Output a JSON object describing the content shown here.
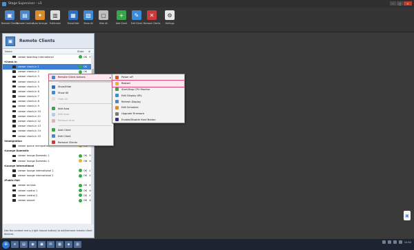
{
  "window": {
    "title": "Stage Supervisor - v3"
  },
  "toolbar": {
    "buttons": [
      {
        "label": "Remote Clients",
        "icon": "monitor-icon",
        "color": "#4a86c8",
        "glyph": "▣"
      },
      {
        "label": "Remote Control",
        "icon": "remote-icon",
        "color": "#4a86c8",
        "glyph": "▤"
      },
      {
        "label": "Auto Arrange",
        "icon": "arrange-icon",
        "color": "#d98a2b",
        "glyph": "✦"
      },
      {
        "label": "FullScreen",
        "icon": "fullscreen-icon",
        "color": "#dedede",
        "glyph": "▥"
      },
      {
        "label": "Show/Hide",
        "icon": "showhide-icon",
        "color": "#2f6fbf",
        "glyph": "▦"
      },
      {
        "label": "Show All",
        "icon": "showall-icon",
        "color": "#3d8ad8",
        "glyph": "▧"
      },
      {
        "label": "Hide All",
        "icon": "hideall-icon",
        "color": "#bfbfbf",
        "glyph": "▢"
      },
      {
        "label": "Add Client",
        "icon": "add-client-icon",
        "color": "#37a64a",
        "glyph": "+"
      },
      {
        "label": "Edit Client",
        "icon": "edit-client-icon",
        "color": "#3d8ad8",
        "glyph": "✎"
      },
      {
        "label": "Remove Clients",
        "icon": "remove-client-icon",
        "color": "#c93a3a",
        "glyph": "✕"
      },
      {
        "label": "Settings",
        "icon": "gear-icon",
        "color": "#e8e8e8",
        "glyph": "⚙"
      }
    ]
  },
  "left_pane": {
    "title": "Remote Clients",
    "columns": {
      "name": "Name",
      "state": "State",
      "num": "#"
    },
    "groups": [
      {
        "label": "",
        "rows": [
          {
            "name": "viewer boarding international",
            "state": "ok",
            "state_text": "OK",
            "num": "35"
          }
        ]
      },
      {
        "label": "Check In",
        "rows": [
          {
            "name": "viewer check-in 1",
            "state": "ok",
            "state_text": "OK",
            "num": "",
            "selected": true
          },
          {
            "name": "viewer check-in 2",
            "state": "ok",
            "state_text": "OK",
            "num": ""
          },
          {
            "name": "viewer check-in 3",
            "state": "ok",
            "state_text": "OK",
            "num": ""
          },
          {
            "name": "viewer check-in 4",
            "state": "ok",
            "state_text": "OK",
            "num": ""
          },
          {
            "name": "viewer check-in 5",
            "state": "ok",
            "state_text": "OK",
            "num": ""
          },
          {
            "name": "viewer check-in 6",
            "state": "ok",
            "state_text": "OK",
            "num": ""
          },
          {
            "name": "viewer check-in 7",
            "state": "ok",
            "state_text": "OK",
            "num": ""
          },
          {
            "name": "viewer check-in 8",
            "state": "ok",
            "state_text": "OK",
            "num": ""
          },
          {
            "name": "viewer check-in 9",
            "state": "ok",
            "state_text": "OK",
            "num": ""
          },
          {
            "name": "viewer check-in 10",
            "state": "ok",
            "state_text": "OK",
            "num": ""
          },
          {
            "name": "viewer check-in 11",
            "state": "ok",
            "state_text": "OK",
            "num": ""
          },
          {
            "name": "viewer check-in 12",
            "state": "ok",
            "state_text": "OK",
            "num": ""
          },
          {
            "name": "viewer check-in 13",
            "state": "ok",
            "state_text": "OK",
            "num": ""
          },
          {
            "name": "viewer check-in 14",
            "state": "ok",
            "state_text": "OK",
            "num": ""
          },
          {
            "name": "viewer check-in 15",
            "state": "ok",
            "state_text": "OK",
            "num": ""
          }
        ]
      },
      {
        "label": "Immigration",
        "rows": [
          {
            "name": "viewer queue immigration",
            "state": "warn",
            "state_text": "ON",
            "num": ""
          }
        ]
      },
      {
        "label": "Lounge Domestic",
        "rows": [
          {
            "name": "viewer lounge Domestic 1",
            "state": "ok",
            "state_text": "OK",
            "num": "39"
          },
          {
            "name": "viewer lounge Domestic 2",
            "state": "warn",
            "state_text": "ON",
            "num": "40"
          }
        ]
      },
      {
        "label": "Lounge International",
        "rows": [
          {
            "name": "viewer lounge international 1",
            "state": "ok",
            "state_text": "OK",
            "num": "41"
          },
          {
            "name": "viewer lounge international 2",
            "state": "ok",
            "state_text": "OK",
            "num": "42"
          }
        ]
      },
      {
        "label": "Public Hall",
        "rows": [
          {
            "name": "viewer arrivals",
            "state": "ok",
            "state_text": "OK",
            "num": "45"
          },
          {
            "name": "viewer control 1",
            "state": "ok",
            "state_text": "OK",
            "num": "46"
          },
          {
            "name": "viewer control 2",
            "state": "ok",
            "state_text": "OK",
            "num": "47"
          },
          {
            "name": "viewer airport",
            "state": "ok",
            "state_text": "OK",
            "num": "48"
          }
        ]
      }
    ],
    "hint": "Use the context menu (right mouse button) to add/remove remote client devices."
  },
  "context_menu": {
    "items": [
      {
        "label": "Remote Client Actions",
        "color": "#4a86c8",
        "submenu": true,
        "disabled": false,
        "highlight": false
      },
      {
        "sep": true
      },
      {
        "label": "Show/Hide",
        "color": "#2f6fbf",
        "disabled": false
      },
      {
        "label": "Show All",
        "color": "#3d8ad8",
        "disabled": false
      },
      {
        "label": "Hide All",
        "color": "#bfbfbf",
        "disabled": true
      },
      {
        "sep": true
      },
      {
        "label": "Add Area",
        "color": "#37a64a",
        "disabled": false
      },
      {
        "label": "Edit Area",
        "color": "#3d8ad8",
        "disabled": true
      },
      {
        "label": "Remove Area",
        "color": "#c93a3a",
        "disabled": true
      },
      {
        "sep": true
      },
      {
        "label": "Add Client",
        "color": "#37a64a",
        "disabled": false
      },
      {
        "label": "Edit Client",
        "color": "#3d8ad8",
        "disabled": false
      },
      {
        "label": "Remove Clients",
        "color": "#c93a3a",
        "disabled": false
      }
    ]
  },
  "submenu": {
    "items": [
      {
        "label": "Power off",
        "color": "#d9552b",
        "highlight": false
      },
      {
        "label": "Restart",
        "color": "#e8b629",
        "highlight": true
      },
      {
        "label": "Start/Stop CPU Monitor",
        "color": "#37a64a",
        "highlight": false
      },
      {
        "label": "Edit Display URL",
        "color": "#3d8ad8",
        "highlight": false
      },
      {
        "label": "Refresh Display",
        "color": "#3d8ad8",
        "highlight": false
      },
      {
        "label": "Edit Schedule",
        "color": "#d98a2b",
        "highlight": false
      },
      {
        "label": "Upgrade Firmware",
        "color": "#7a7a7a",
        "highlight": false
      },
      {
        "label": "Enable/Disable Hard Button",
        "color": "#2f2f8f",
        "highlight": false
      }
    ]
  },
  "taskbar": {
    "apps": [
      "⊞",
      "e",
      "▤",
      "◉",
      "▣",
      "✉",
      "▦",
      "◈",
      "▥"
    ],
    "time": "12:42"
  }
}
